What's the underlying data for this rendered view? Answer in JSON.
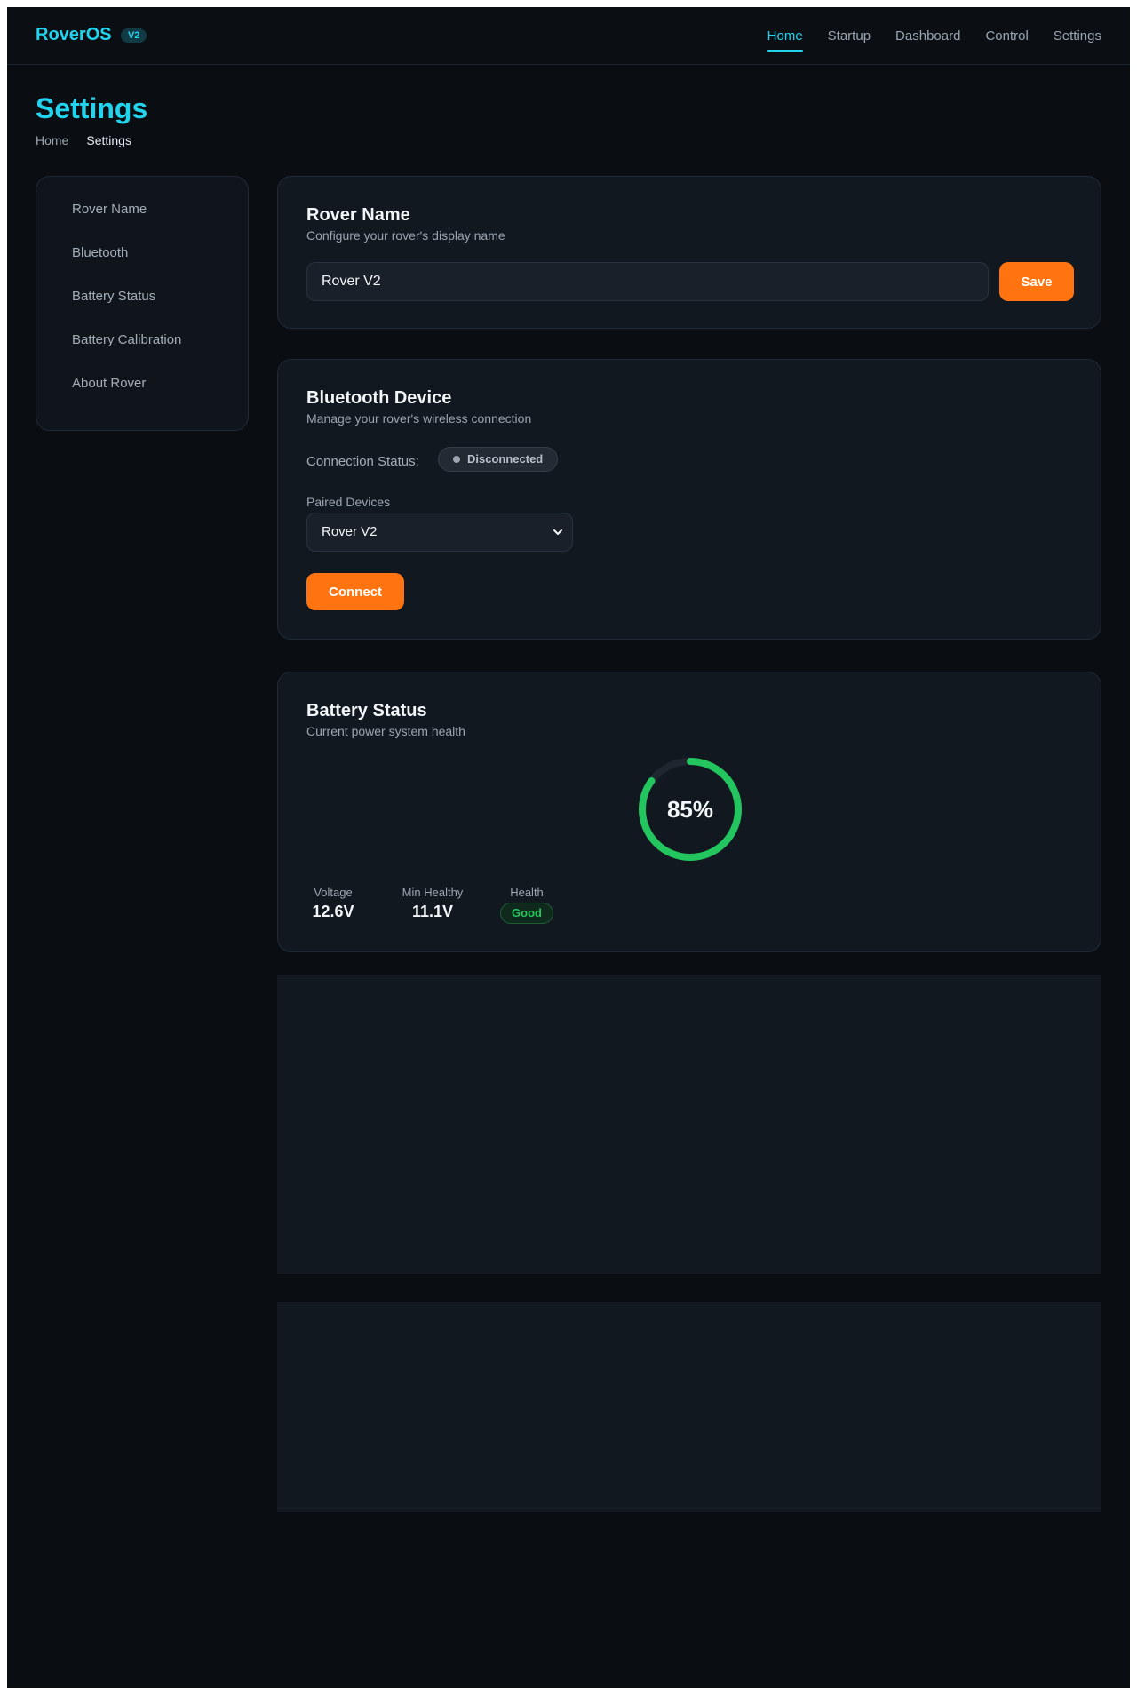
{
  "app": {
    "brand": "RoverOS",
    "version_badge": "V2",
    "accent_color": "#22d3ee",
    "action_color": "#ff7410",
    "success_color": "#22c55e"
  },
  "nav": {
    "items": [
      {
        "label": "Home",
        "active": true
      },
      {
        "label": "Startup",
        "active": false
      },
      {
        "label": "Dashboard",
        "active": false
      },
      {
        "label": "Control",
        "active": false
      },
      {
        "label": "Settings",
        "active": false
      }
    ]
  },
  "header": {
    "title": "Settings",
    "breadcrumb": [
      "Home",
      "Settings"
    ]
  },
  "sidebar": {
    "items": [
      {
        "label": "Rover Name"
      },
      {
        "label": "Bluetooth"
      },
      {
        "label": "Battery Status"
      },
      {
        "label": "Battery Calibration"
      },
      {
        "label": "About Rover"
      }
    ]
  },
  "rover_name": {
    "title": "Rover Name",
    "subtitle": "Configure your rover's display name",
    "input_value": "Rover V2",
    "save_label": "Save"
  },
  "bluetooth": {
    "title": "Bluetooth Device",
    "subtitle": "Manage your rover's wireless connection",
    "status_label": "Connection Status:",
    "status_value": "Disconnected",
    "paired_label": "Paired Devices",
    "selected_device": "Rover V2",
    "connect_label": "Connect"
  },
  "battery": {
    "title": "Battery Status",
    "subtitle": "Current power system health",
    "percent_label": "85%",
    "percent": 85,
    "stats": [
      {
        "label": "Voltage",
        "value": "12.6V"
      },
      {
        "label": "Min Healthy",
        "value": "11.1V"
      },
      {
        "label": "Health",
        "value": "Good"
      }
    ]
  }
}
